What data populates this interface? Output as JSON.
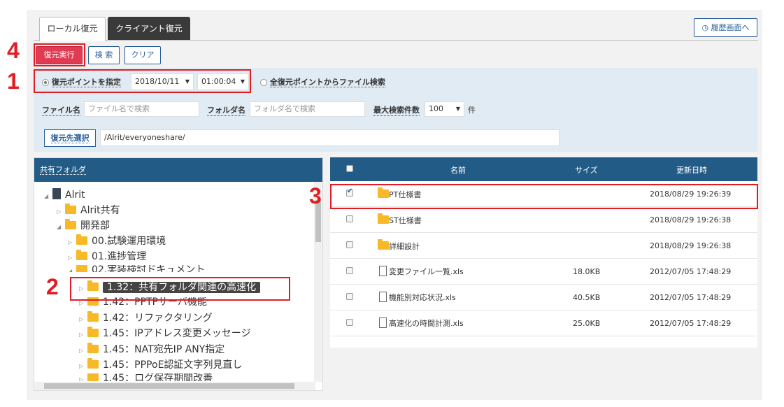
{
  "tabs": [
    {
      "label": "ローカル復元"
    },
    {
      "label": "クライアント復元"
    }
  ],
  "history_button": "履歴画面へ",
  "toolbar": {
    "exec_label": "復元実行",
    "search_label": "検 索",
    "clear_label": "クリア"
  },
  "filter": {
    "restore_point_label": "復元ポイントを指定",
    "date_value": "2018/10/11",
    "time_value": "01:00:04",
    "all_points_label": "全復元ポイントからファイル検索",
    "filename_label": "ファイル名",
    "filename_placeholder": "ファイル名で検索",
    "foldername_label": "フォルダ名",
    "foldername_placeholder": "フォルダ名で検索",
    "max_results_label": "最大検索件数",
    "max_results_value": "100",
    "max_results_unit": "件",
    "dest_button": "復元先選択",
    "dest_path": "/Alrit/everyoneshare/"
  },
  "tree": {
    "header": "共有フォルダ",
    "items": [
      {
        "label": "Alrit"
      },
      {
        "label": "Alrit共有"
      },
      {
        "label": "開発部"
      },
      {
        "label": "00.試験運用環境"
      },
      {
        "label": "01.進捗管理"
      },
      {
        "label": "02.実装検討ドキュメント"
      },
      {
        "label": "1.32：共有フォルダ関連の高速化"
      },
      {
        "label": "1.42：PPTPサーバ機能"
      },
      {
        "label": "1.42：リファクタリング"
      },
      {
        "label": "1.45：IPアドレス変更メッセージ"
      },
      {
        "label": "1.45：NAT宛先IP ANY指定"
      },
      {
        "label": "1.45：PPPoE認証文字列見直し"
      },
      {
        "label": "1.45：ログ保存期間改善"
      }
    ]
  },
  "files": {
    "headers": {
      "name": "名前",
      "size": "サイズ",
      "date": "更新日時"
    },
    "rows": [
      {
        "name": "PT仕様書",
        "size": "",
        "date": "2018/08/29 19:26:39",
        "checked": true
      },
      {
        "name": "ST仕様書",
        "size": "",
        "date": "2018/08/29 19:26:38",
        "checked": false
      },
      {
        "name": "詳細設計",
        "size": "",
        "date": "2018/08/29 19:26:38",
        "checked": false
      },
      {
        "name": "変更ファイル一覧.xls",
        "size": "18.0KB",
        "date": "2012/07/05 17:48:29",
        "checked": false
      },
      {
        "name": "機能別対応状況.xls",
        "size": "40.5KB",
        "date": "2012/07/05 17:48:29",
        "checked": false
      },
      {
        "name": "高速化の時間計測.xls",
        "size": "25.0KB",
        "date": "2012/07/05 17:48:29",
        "checked": false
      }
    ]
  },
  "annotations": [
    "1",
    "2",
    "3",
    "4"
  ],
  "colors": {
    "accent_red": "#e21c23",
    "header_blue": "#235b87",
    "exec_button": "#e03b52",
    "filter_bg": "#e1ebf3"
  }
}
